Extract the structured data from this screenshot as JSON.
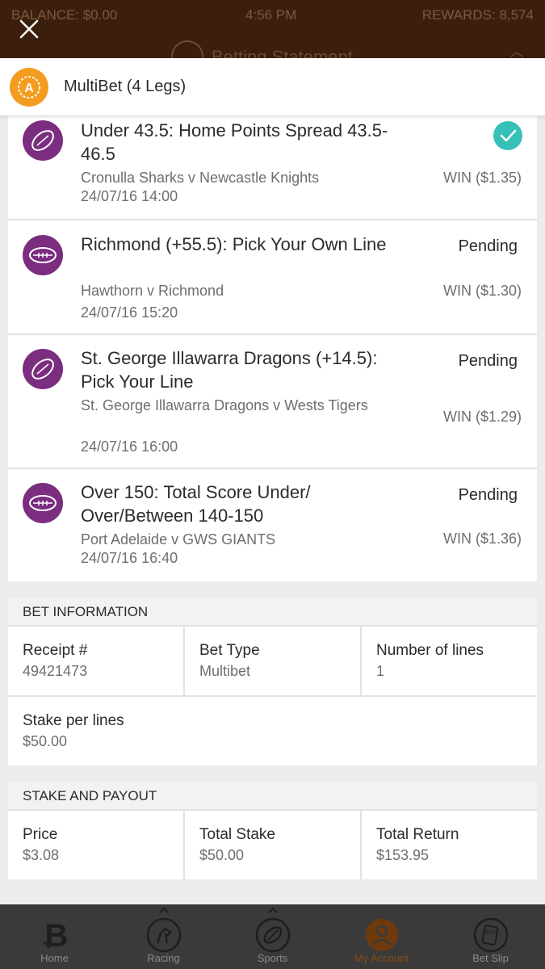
{
  "status_bar": {
    "balance": "BALANCE: $0.00",
    "time": "4:56 PM",
    "rewards": "REWARDS: 8,574",
    "background_title": "Betting Statement"
  },
  "header": {
    "title": "MultiBet (4 Legs)",
    "badge_icon": "account-badge-icon",
    "close_icon": "close-icon"
  },
  "legs": [
    {
      "icon": "rugby-league-ball-icon",
      "market": "Under 43.5: Home Points Spread 43.5-46.5",
      "event": "Cronulla Sharks v Newcastle Knights",
      "datetime": "24/07/16 14:00",
      "status": "",
      "won": true,
      "win": "WIN ($1.35)"
    },
    {
      "icon": "afl-ball-icon",
      "market": "Richmond (+55.5): Pick Your Own Line",
      "event": "Hawthorn v Richmond",
      "datetime": "24/07/16 15:20",
      "status": "Pending",
      "won": false,
      "win": "WIN ($1.30)"
    },
    {
      "icon": "rugby-league-ball-icon",
      "market": "St. George Illawarra Dragons (+14.5): Pick Your Line",
      "event": "St. George Illawarra Dragons v Wests Tigers",
      "datetime": "24/07/16 16:00",
      "status": "Pending",
      "won": false,
      "win": "WIN ($1.29)"
    },
    {
      "icon": "afl-ball-icon",
      "market": "Over 150: Total Score Under/ Over/Between 140-150",
      "event": "Port Adelaide v GWS GIANTS",
      "datetime": "24/07/16 16:40",
      "status": "Pending",
      "won": false,
      "win": "WIN ($1.36)"
    }
  ],
  "bet_information": {
    "heading": "BET INFORMATION",
    "receipt_label": "Receipt #",
    "receipt_value": "49421473",
    "bet_type_label": "Bet Type",
    "bet_type_value": "Multibet",
    "lines_label": "Number of lines",
    "lines_value": "1",
    "stake_label": "Stake per lines",
    "stake_value": "$50.00"
  },
  "stake_payout": {
    "heading": "STAKE AND PAYOUT",
    "price_label": "Price",
    "price_value": "$3.08",
    "total_stake_label": "Total Stake",
    "total_stake_value": "$50.00",
    "total_return_label": "Total Return",
    "total_return_value": "$153.95"
  },
  "tabbar": {
    "tabs": [
      {
        "label": "Home",
        "icon": "home-logo-icon",
        "active": false
      },
      {
        "label": "Racing",
        "icon": "horse-icon",
        "active": false
      },
      {
        "label": "Sports",
        "icon": "sports-ball-icon",
        "active": false
      },
      {
        "label": "My Account",
        "icon": "account-icon",
        "active": true
      },
      {
        "label": "Bet Slip",
        "icon": "bet-slip-icon",
        "active": false
      }
    ]
  },
  "colors": {
    "accent": "#f39c1f",
    "sport_icon_bg": "#7b2d7f",
    "win_check": "#36c0b8",
    "header_bg": "#3b1f0c",
    "tabbar_bg": "#3a3a3a"
  }
}
